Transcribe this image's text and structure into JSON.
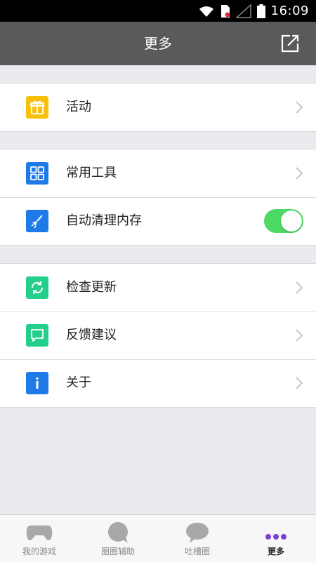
{
  "status_bar": {
    "time": "16:09"
  },
  "header": {
    "title": "更多"
  },
  "groups": [
    {
      "items": [
        {
          "label": "活动",
          "icon": "gift-icon",
          "color": "#f7c00a"
        }
      ]
    },
    {
      "items": [
        {
          "label": "常用工具",
          "icon": "grid-icon",
          "color": "#1e7ae6"
        },
        {
          "label": "自动清理内存",
          "icon": "broom-icon",
          "color": "#1e7ae6",
          "toggle_on": true
        }
      ]
    },
    {
      "items": [
        {
          "label": "检查更新",
          "icon": "refresh-icon",
          "color": "#24cf8c"
        },
        {
          "label": "反馈建议",
          "icon": "chat-icon",
          "color": "#24cf8c"
        },
        {
          "label": "关于",
          "icon": "info-icon",
          "color": "#1e7ae6"
        }
      ]
    }
  ],
  "tabbar": {
    "tabs": [
      {
        "label": "我的游戏",
        "icon": "gamepad-icon",
        "active": false
      },
      {
        "label": "圈圈辅助",
        "icon": "circle-chat-icon",
        "active": false
      },
      {
        "label": "吐槽圈",
        "icon": "speech-bubble-icon",
        "active": false
      },
      {
        "label": "更多",
        "icon": "more-dots-icon",
        "active": true
      }
    ],
    "active_color": "#7b3fd1"
  }
}
